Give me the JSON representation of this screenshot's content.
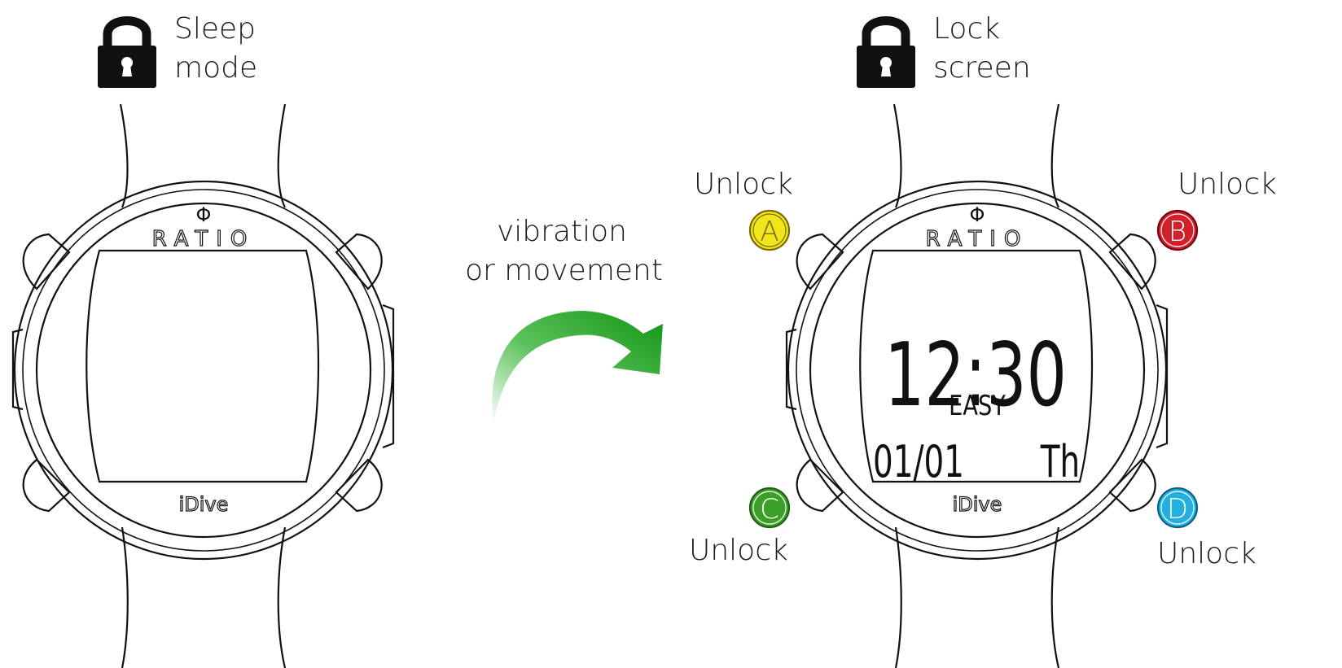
{
  "left_state": {
    "title_line1": "Sleep",
    "title_line2": "mode",
    "brand": "RATIO",
    "brand_symbol": "Φ",
    "model": "iDive",
    "icon": "padlock-icon"
  },
  "transition": {
    "line1": "vibration",
    "line2": "or movement",
    "icon": "curved-arrow-icon",
    "arrow_color": "#1a9a1a"
  },
  "right_state": {
    "title_line1": "Lock",
    "title_line2": "screen",
    "brand": "RATIO",
    "brand_symbol": "Φ",
    "model": "iDive",
    "icon": "padlock-icon",
    "screen": {
      "time": "12:30",
      "mode": "EASY",
      "date": "01/01",
      "day": "Th"
    },
    "buttons": [
      {
        "letter": "A",
        "action": "Unlock",
        "color": "#f2e61a"
      },
      {
        "letter": "B",
        "action": "Unlock",
        "color": "#d0202a"
      },
      {
        "letter": "C",
        "action": "Unlock",
        "color": "#3aa02a"
      },
      {
        "letter": "D",
        "action": "Unlock",
        "color": "#22b0e0"
      }
    ]
  }
}
